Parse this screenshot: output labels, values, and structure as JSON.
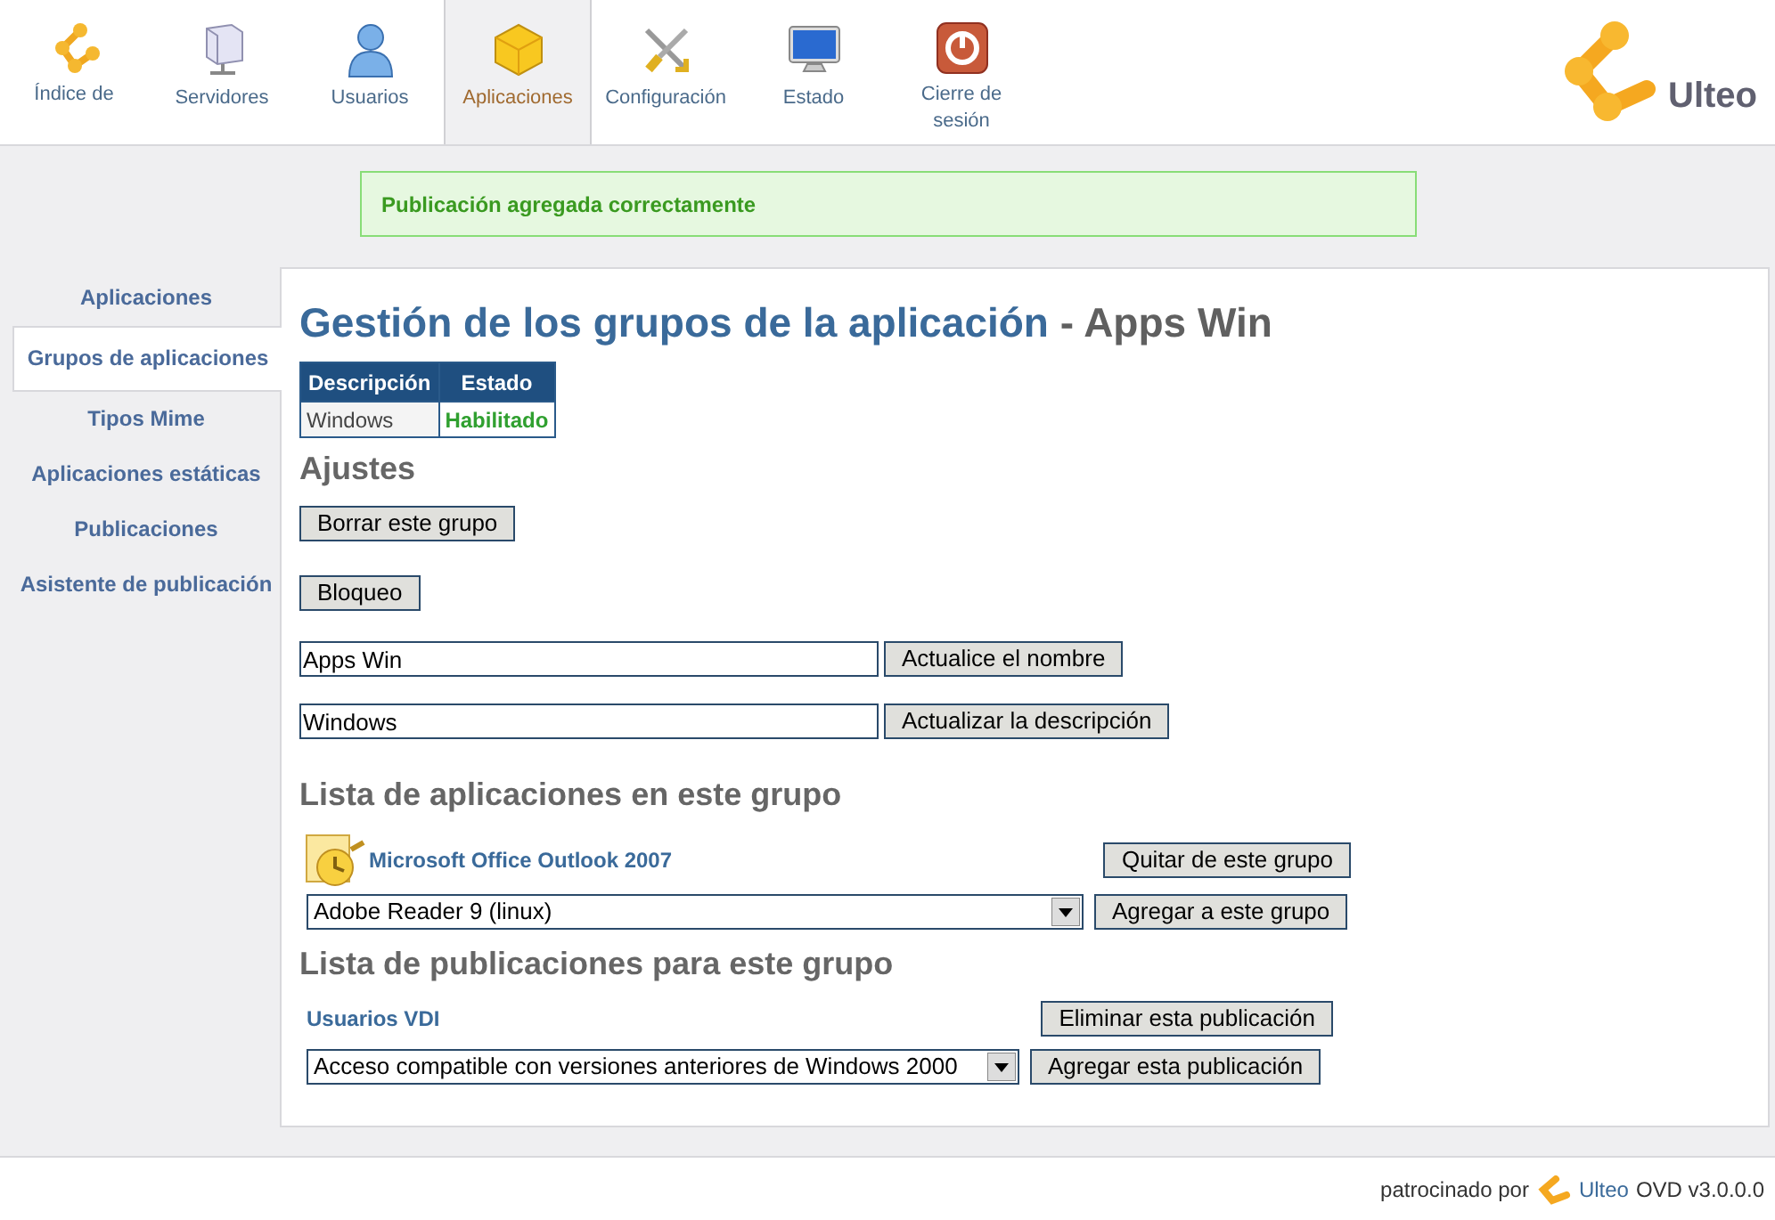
{
  "nav": {
    "tabs": [
      {
        "label": "Índice de",
        "kind": "nodes",
        "selected": false
      },
      {
        "label": "Servidores",
        "kind": "server",
        "selected": false
      },
      {
        "label": "Usuarios",
        "kind": "user",
        "selected": false
      },
      {
        "label": "Aplicaciones",
        "kind": "box",
        "selected": true
      },
      {
        "label": "Configuración",
        "kind": "tools",
        "selected": false
      },
      {
        "label": "Estado",
        "kind": "monitor",
        "selected": false
      },
      {
        "label": "Cierre de sesión",
        "kind": "power",
        "selected": false
      }
    ],
    "logo": "Ulteo"
  },
  "notice": "Publicación agregada correctamente",
  "sidebar": {
    "items": [
      {
        "label": "Aplicaciones",
        "selected": false
      },
      {
        "label": "Grupos de aplicaciones",
        "selected": true
      },
      {
        "label": "Tipos Mime",
        "selected": false
      },
      {
        "label": "Aplicaciones estáticas",
        "selected": false
      },
      {
        "label": "Publicaciones",
        "selected": false
      },
      {
        "label": "Asistente de publicación",
        "selected": false
      }
    ]
  },
  "content": {
    "title": "Gestión de los grupos de la aplicación",
    "title_suffix": " - Apps Win",
    "table": {
      "columns": [
        "Descripción",
        "Estado"
      ],
      "rows": [
        [
          "Windows",
          "Habilitado"
        ]
      ]
    },
    "settings": {
      "heading": "Ajustes",
      "delete_button": "Borrar este grupo",
      "block_button": "Bloqueo",
      "name": {
        "value": "Apps Win",
        "button": "Actualice el nombre"
      },
      "description": {
        "value": "Windows",
        "button": "Actualizar la descripción"
      }
    },
    "apps": {
      "heading": "Lista de aplicaciones en este grupo",
      "items": [
        {
          "name": "Microsoft Office Outlook 2007",
          "button": "Quitar de este grupo"
        }
      ],
      "select": "Adobe Reader 9 (linux)",
      "add_button": "Agregar a este grupo"
    },
    "publications": {
      "heading": "Lista de publicaciones para este grupo",
      "items": [
        {
          "name": "Usuarios VDI",
          "button": "Eliminar esta publicación"
        }
      ],
      "select": "Acceso compatible con versiones anteriores de Windows 2000",
      "add_button": "Agregar esta publicación"
    }
  },
  "footer": {
    "prefix": "patrocinado por",
    "brand": "Ulteo",
    "suffix": "OVD v3.0.0.0"
  }
}
